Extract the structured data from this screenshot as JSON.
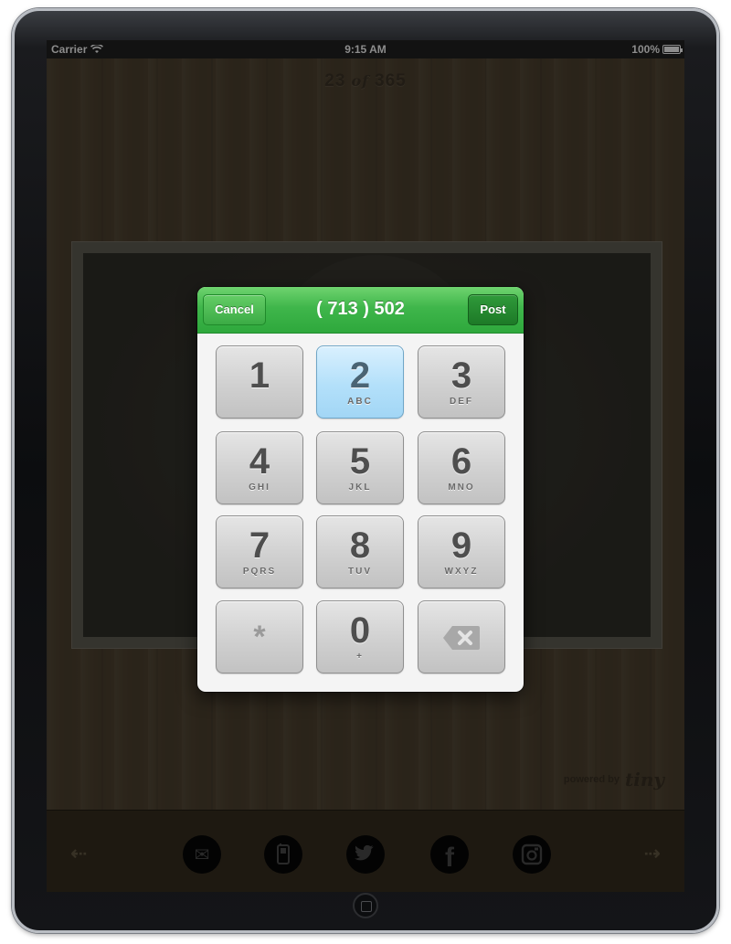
{
  "status_bar": {
    "carrier": "Carrier",
    "time": "9:15 AM",
    "battery": "100%"
  },
  "page_counter": {
    "current": "23",
    "of": "of",
    "total": "365"
  },
  "powered_by": {
    "label": "powered by",
    "brand": "tiny"
  },
  "dialog": {
    "title": "( 713 ) 502",
    "cancel_label": "Cancel",
    "post_label": "Post"
  },
  "keypad": [
    {
      "digit": "1",
      "letters": ""
    },
    {
      "digit": "2",
      "letters": "ABC",
      "active": true
    },
    {
      "digit": "3",
      "letters": "DEF"
    },
    {
      "digit": "4",
      "letters": "GHI"
    },
    {
      "digit": "5",
      "letters": "JKL"
    },
    {
      "digit": "6",
      "letters": "MNO"
    },
    {
      "digit": "7",
      "letters": "PQRS"
    },
    {
      "digit": "8",
      "letters": "TUV"
    },
    {
      "digit": "9",
      "letters": "WXYZ"
    },
    {
      "digit": "*",
      "letters": ""
    },
    {
      "digit": "0",
      "letters": "+"
    },
    {
      "digit": "",
      "letters": "",
      "icon": "delete-icon"
    }
  ],
  "toolbar": {
    "icons": [
      "email-icon",
      "phone-icon",
      "twitter-icon",
      "facebook-icon",
      "instagram-icon"
    ]
  },
  "colors": {
    "header_green": "#3fb64b",
    "active_key_blue": "#b3e0fa",
    "wood": "#3d3426"
  }
}
